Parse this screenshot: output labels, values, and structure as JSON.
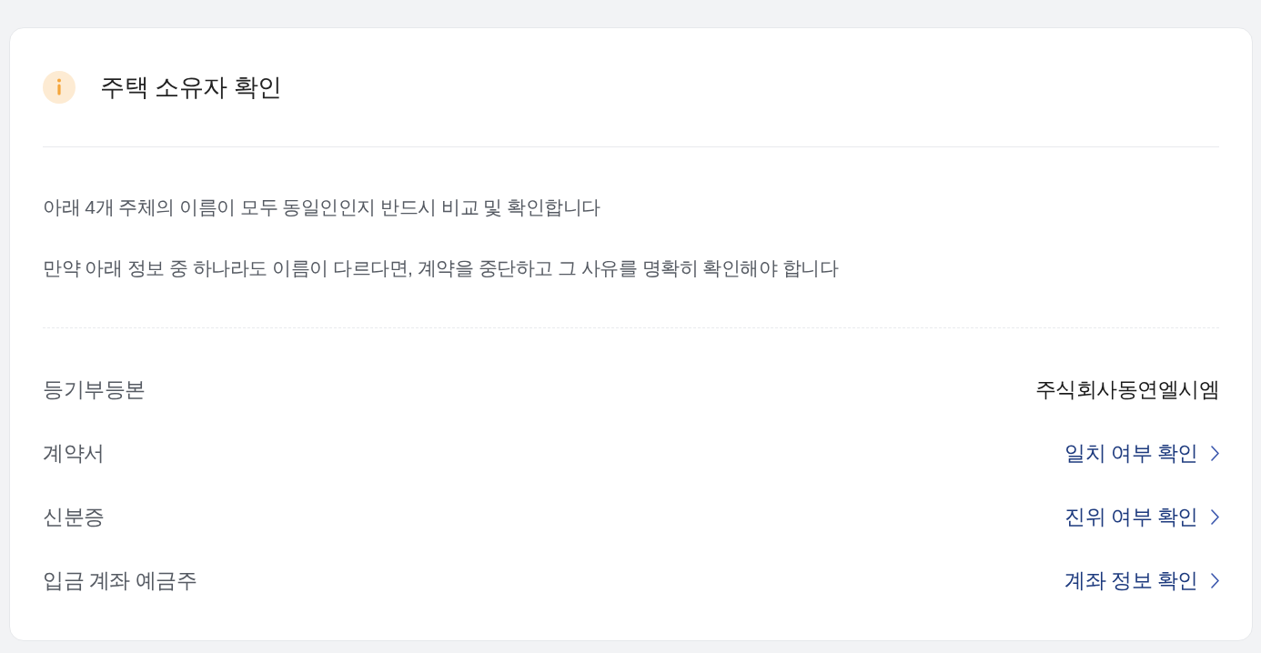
{
  "header": {
    "title": "주택 소유자 확인"
  },
  "notes": [
    "아래 4개 주체의 이름이 모두 동일인인지 반드시 비교 및 확인합니다",
    "만약 아래 정보 중 하나라도 이름이 다르다면, 계약을 중단하고 그 사유를 명확히 확인해야 합니다"
  ],
  "rows": [
    {
      "label": "등기부등본",
      "kind": "value",
      "value": "주식회사동연엘시엠"
    },
    {
      "label": "계약서",
      "kind": "link",
      "value": "일치 여부 확인"
    },
    {
      "label": "신분증",
      "kind": "link",
      "value": "진위 여부 확인"
    },
    {
      "label": "입금 계좌 예금주",
      "kind": "link",
      "value": "계좌 정보 확인"
    }
  ]
}
